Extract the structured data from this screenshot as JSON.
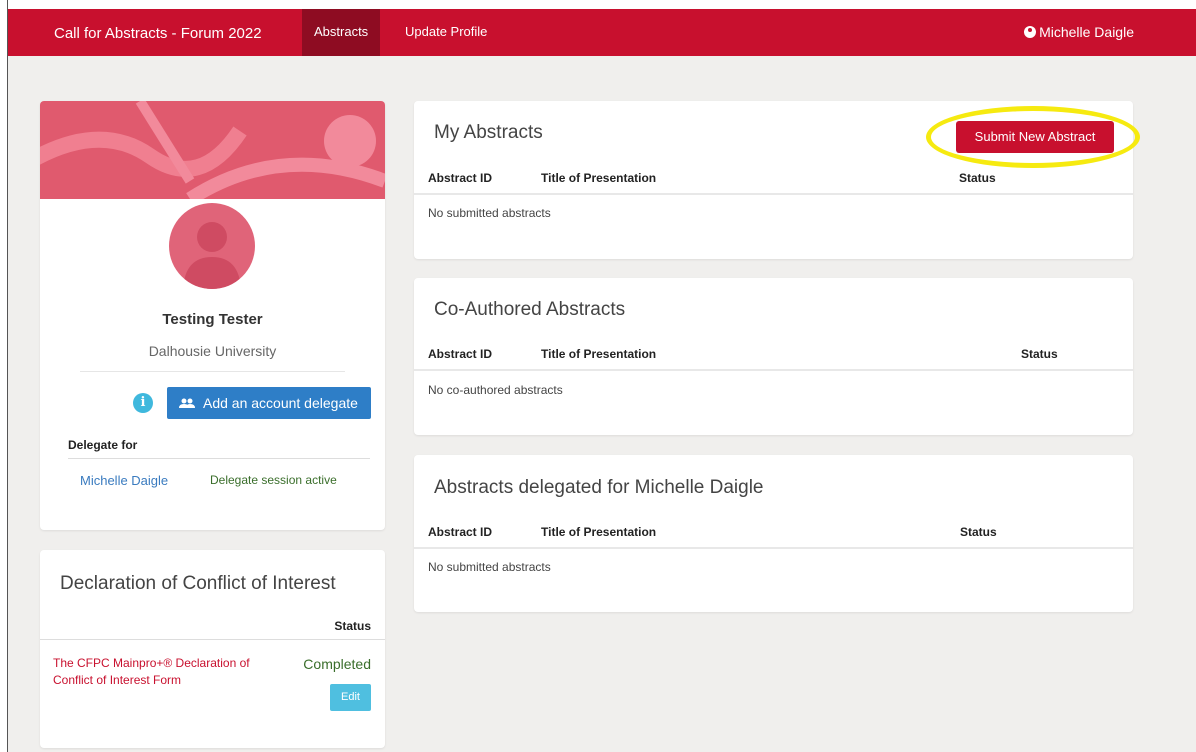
{
  "navbar": {
    "brand": "Call for Abstracts - Forum 2022",
    "tabs": [
      "Abstracts",
      "Update Profile"
    ],
    "user": "Michelle Daigle",
    "color": "#c8102e"
  },
  "profile": {
    "name": "Testing Tester",
    "organization": "Dalhousie University",
    "delegate_button": "Add an account delegate",
    "delegate_for_label": "Delegate for",
    "delegate_name": "Michelle Daigle",
    "delegate_status": "Delegate session active"
  },
  "conflict": {
    "title": "Declaration of Conflict of Interest",
    "status_header": "Status",
    "form_link": "The CFPC Mainpro+® Declaration of Conflict of Interest Form",
    "form_status": "Completed",
    "edit_label": "Edit"
  },
  "my_abstracts": {
    "title": "My Abstracts",
    "submit_button": "Submit New Abstract",
    "columns": [
      "Abstract ID",
      "Title of Presentation",
      "Status"
    ],
    "empty": "No submitted abstracts"
  },
  "coauthored": {
    "title": "Co-Authored Abstracts",
    "columns": [
      "Abstract ID",
      "Title of Presentation",
      "Status"
    ],
    "empty": "No co-authored abstracts"
  },
  "delegated": {
    "title": "Abstracts delegated for Michelle Daigle",
    "columns": [
      "Abstract ID",
      "Title of Presentation",
      "Status"
    ],
    "empty": "No submitted abstracts"
  },
  "icons": [
    "user-circle-icon",
    "avatar-silhouette-icon",
    "info-icon",
    "people-icon"
  ]
}
